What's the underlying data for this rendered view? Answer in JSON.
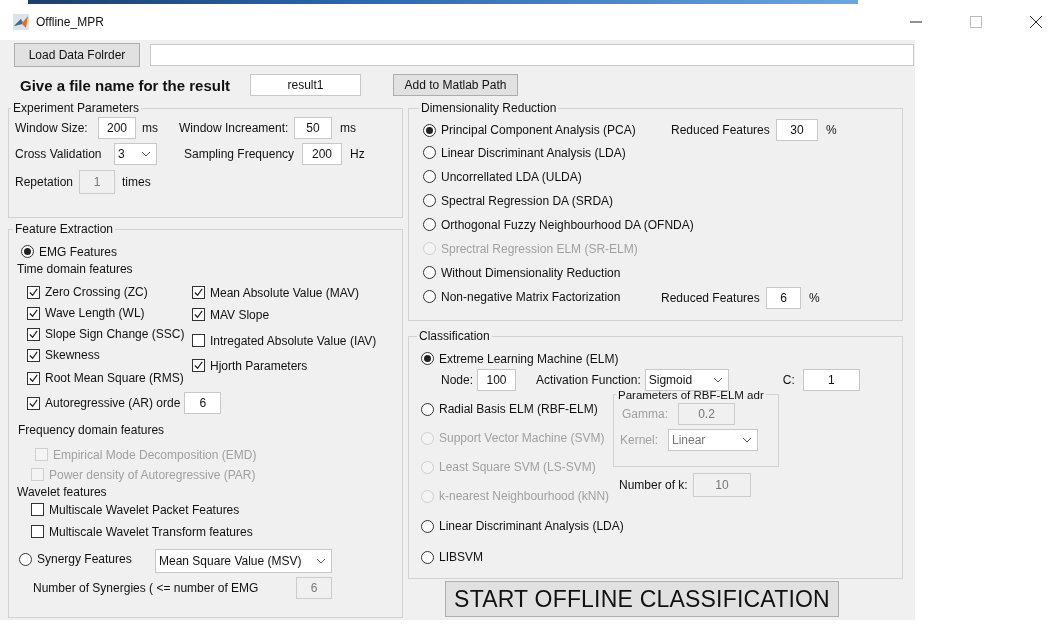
{
  "window": {
    "title": "Offline_MPR"
  },
  "load_button": "Load Data Folrder",
  "result_name": {
    "label": "Give a file name for the result",
    "value": "result1"
  },
  "add_path_button": "Add to Matlab Path",
  "experiment_parameters": {
    "title": "Experiment Parameters",
    "window_size": {
      "label": "Window Size:",
      "value": "200",
      "unit": "ms"
    },
    "window_increment": {
      "label": "Window Increament:",
      "value": "50",
      "unit": "ms"
    },
    "cross_validation": {
      "label": "Cross Validation",
      "value": "3"
    },
    "sampling_frequency": {
      "label": "Sampling Frequency",
      "value": "200",
      "unit": "Hz"
    },
    "repetition": {
      "label": "Repetation",
      "value": "1",
      "unit": "times",
      "disabled": true
    }
  },
  "feature_extraction": {
    "title": "Feature Extraction",
    "emg": {
      "label": "EMG Features",
      "selected": true
    },
    "time_domain": {
      "title": "Time domain features",
      "left": [
        {
          "label": "Zero Crossing (ZC)",
          "checked": true
        },
        {
          "label": "Wave Length (WL)",
          "checked": true
        },
        {
          "label": "Slope Sign Change (SSC)",
          "checked": true
        },
        {
          "label": "Skewness",
          "checked": true
        },
        {
          "label": "Root Mean Square (RMS)",
          "checked": true
        },
        {
          "label": "Autoregressive (AR) orde",
          "checked": true,
          "value": "6"
        }
      ],
      "right": [
        {
          "label": "Mean Absolute Value (MAV)",
          "checked": true
        },
        {
          "label": "MAV Slope",
          "checked": true
        },
        {
          "label": "Intregated Absolute Value (IAV)",
          "checked": false
        },
        {
          "label": "Hjorth Parameters",
          "checked": true
        }
      ]
    },
    "frequency_domain": {
      "title": "Frequency domain features",
      "items": [
        {
          "label": "Empirical Mode Decomposition (EMD)",
          "checked": false,
          "disabled": true
        },
        {
          "label": "Power density of Autoregressive (PAR)",
          "checked": false,
          "disabled": true
        }
      ]
    },
    "wavelet": {
      "title": "Wavelet features",
      "items": [
        {
          "label": "Multiscale Wavelet Packet Features",
          "checked": false,
          "disabled": false
        },
        {
          "label": "Multiscale Wavelet Transform features",
          "checked": false,
          "disabled": false
        }
      ]
    },
    "synergy": {
      "label": "Synergy Features",
      "selected": false,
      "method": "Mean Square Value (MSV)",
      "count": {
        "label": "Number of Synergies ( <= number of EMG",
        "value": "6",
        "disabled": true
      }
    }
  },
  "dimensionality_reduction": {
    "title": "Dimensionality Reduction",
    "methods": [
      {
        "label": "Principal Component Analysis (PCA)",
        "selected": true,
        "disabled": false,
        "reduced": {
          "label": "Reduced Features",
          "value": "30",
          "unit": "%"
        }
      },
      {
        "label": "Linear Discriminant Analysis (LDA)",
        "selected": false,
        "disabled": false
      },
      {
        "label": "Uncorrellated LDA (ULDA)",
        "selected": false,
        "disabled": false
      },
      {
        "label": "Spectral Regression DA (SRDA)",
        "selected": false,
        "disabled": false
      },
      {
        "label": "Orthogonal Fuzzy Neighbourhood DA (OFNDA)",
        "selected": false,
        "disabled": false
      },
      {
        "label": "Sprectral Regression ELM (SR-ELM)",
        "selected": false,
        "disabled": true
      },
      {
        "label": "Without Dimensionality Reduction",
        "selected": false,
        "disabled": false
      },
      {
        "label": "Non-negative Matrix Factorization",
        "selected": false,
        "disabled": false,
        "reduced": {
          "label": "Reduced Features",
          "value": "6",
          "unit": "%"
        }
      }
    ]
  },
  "classification": {
    "title": "Classification",
    "methods": [
      {
        "label": "Extreme Learning Machine (ELM)",
        "selected": true,
        "disabled": false
      },
      {
        "label": "Radial Basis ELM (RBF-ELM)",
        "selected": false,
        "disabled": false
      },
      {
        "label": "Support Vector Machine (SVM)",
        "selected": false,
        "disabled": true
      },
      {
        "label": "Least Square SVM (LS-SVM)",
        "selected": false,
        "disabled": true
      },
      {
        "label": "k-nearest Neighbourhood (kNN)",
        "selected": false,
        "disabled": true
      },
      {
        "label": "Linear Discriminant Analysis (LDA)",
        "selected": false,
        "disabled": false
      },
      {
        "label": "LIBSVM",
        "selected": false,
        "disabled": false
      }
    ],
    "elm": {
      "node": {
        "label": "Node:",
        "value": "100"
      },
      "activation": {
        "label": "Activation Function:",
        "value": "Sigmoid"
      },
      "c": {
        "label": "C:",
        "value": "1"
      }
    },
    "rbf_params": {
      "title": "Parameters of RBF-ELM adr",
      "disabled": true,
      "gamma": {
        "label": "Gamma:",
        "value": "0.2"
      },
      "kernel": {
        "label": "Kernel:",
        "value": "Linear"
      }
    },
    "knn": {
      "label": "Number of k:",
      "value": "10",
      "disabled": true
    }
  },
  "start_button": "START OFFLINE CLASSIFICATION"
}
